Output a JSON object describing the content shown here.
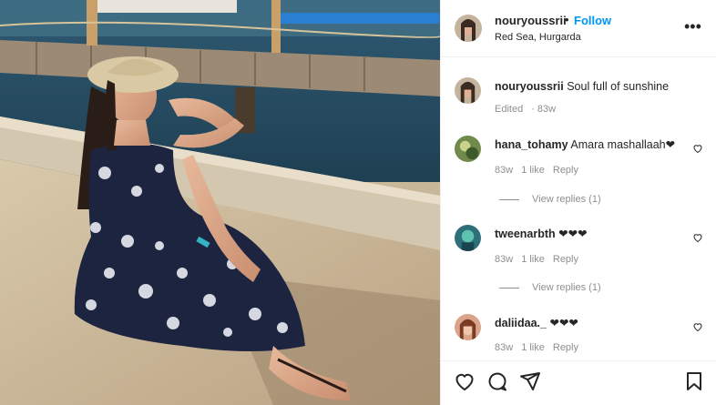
{
  "post": {
    "username": "nouryoussrii",
    "dot": "•",
    "follow_label": "Follow",
    "location": "Red Sea, Hurgarda",
    "more_icon": "more-options-icon"
  },
  "caption": {
    "username": "nouryoussrii",
    "text": "Soul full of sunshine",
    "edited": "Edited",
    "age": "83w"
  },
  "comments": [
    {
      "username": "hana_tohamy",
      "text": "Amara mashallaah❤",
      "age": "83w",
      "likes": "1 like",
      "reply": "Reply",
      "view_replies": "View replies (1)"
    },
    {
      "username": "tweenarbth",
      "text": "❤❤❤",
      "age": "83w",
      "likes": "1 like",
      "reply": "Reply",
      "view_replies": "View replies (1)"
    },
    {
      "username": "daliidaa._",
      "text": "❤❤❤",
      "age": "83w",
      "likes": "1 like",
      "reply": "Reply"
    }
  ],
  "actions": [
    "like-icon",
    "comment-icon",
    "share-icon",
    "save-icon"
  ],
  "colors": {
    "accent": "#0095f6",
    "muted": "#8e8e8e",
    "text": "#262626"
  }
}
